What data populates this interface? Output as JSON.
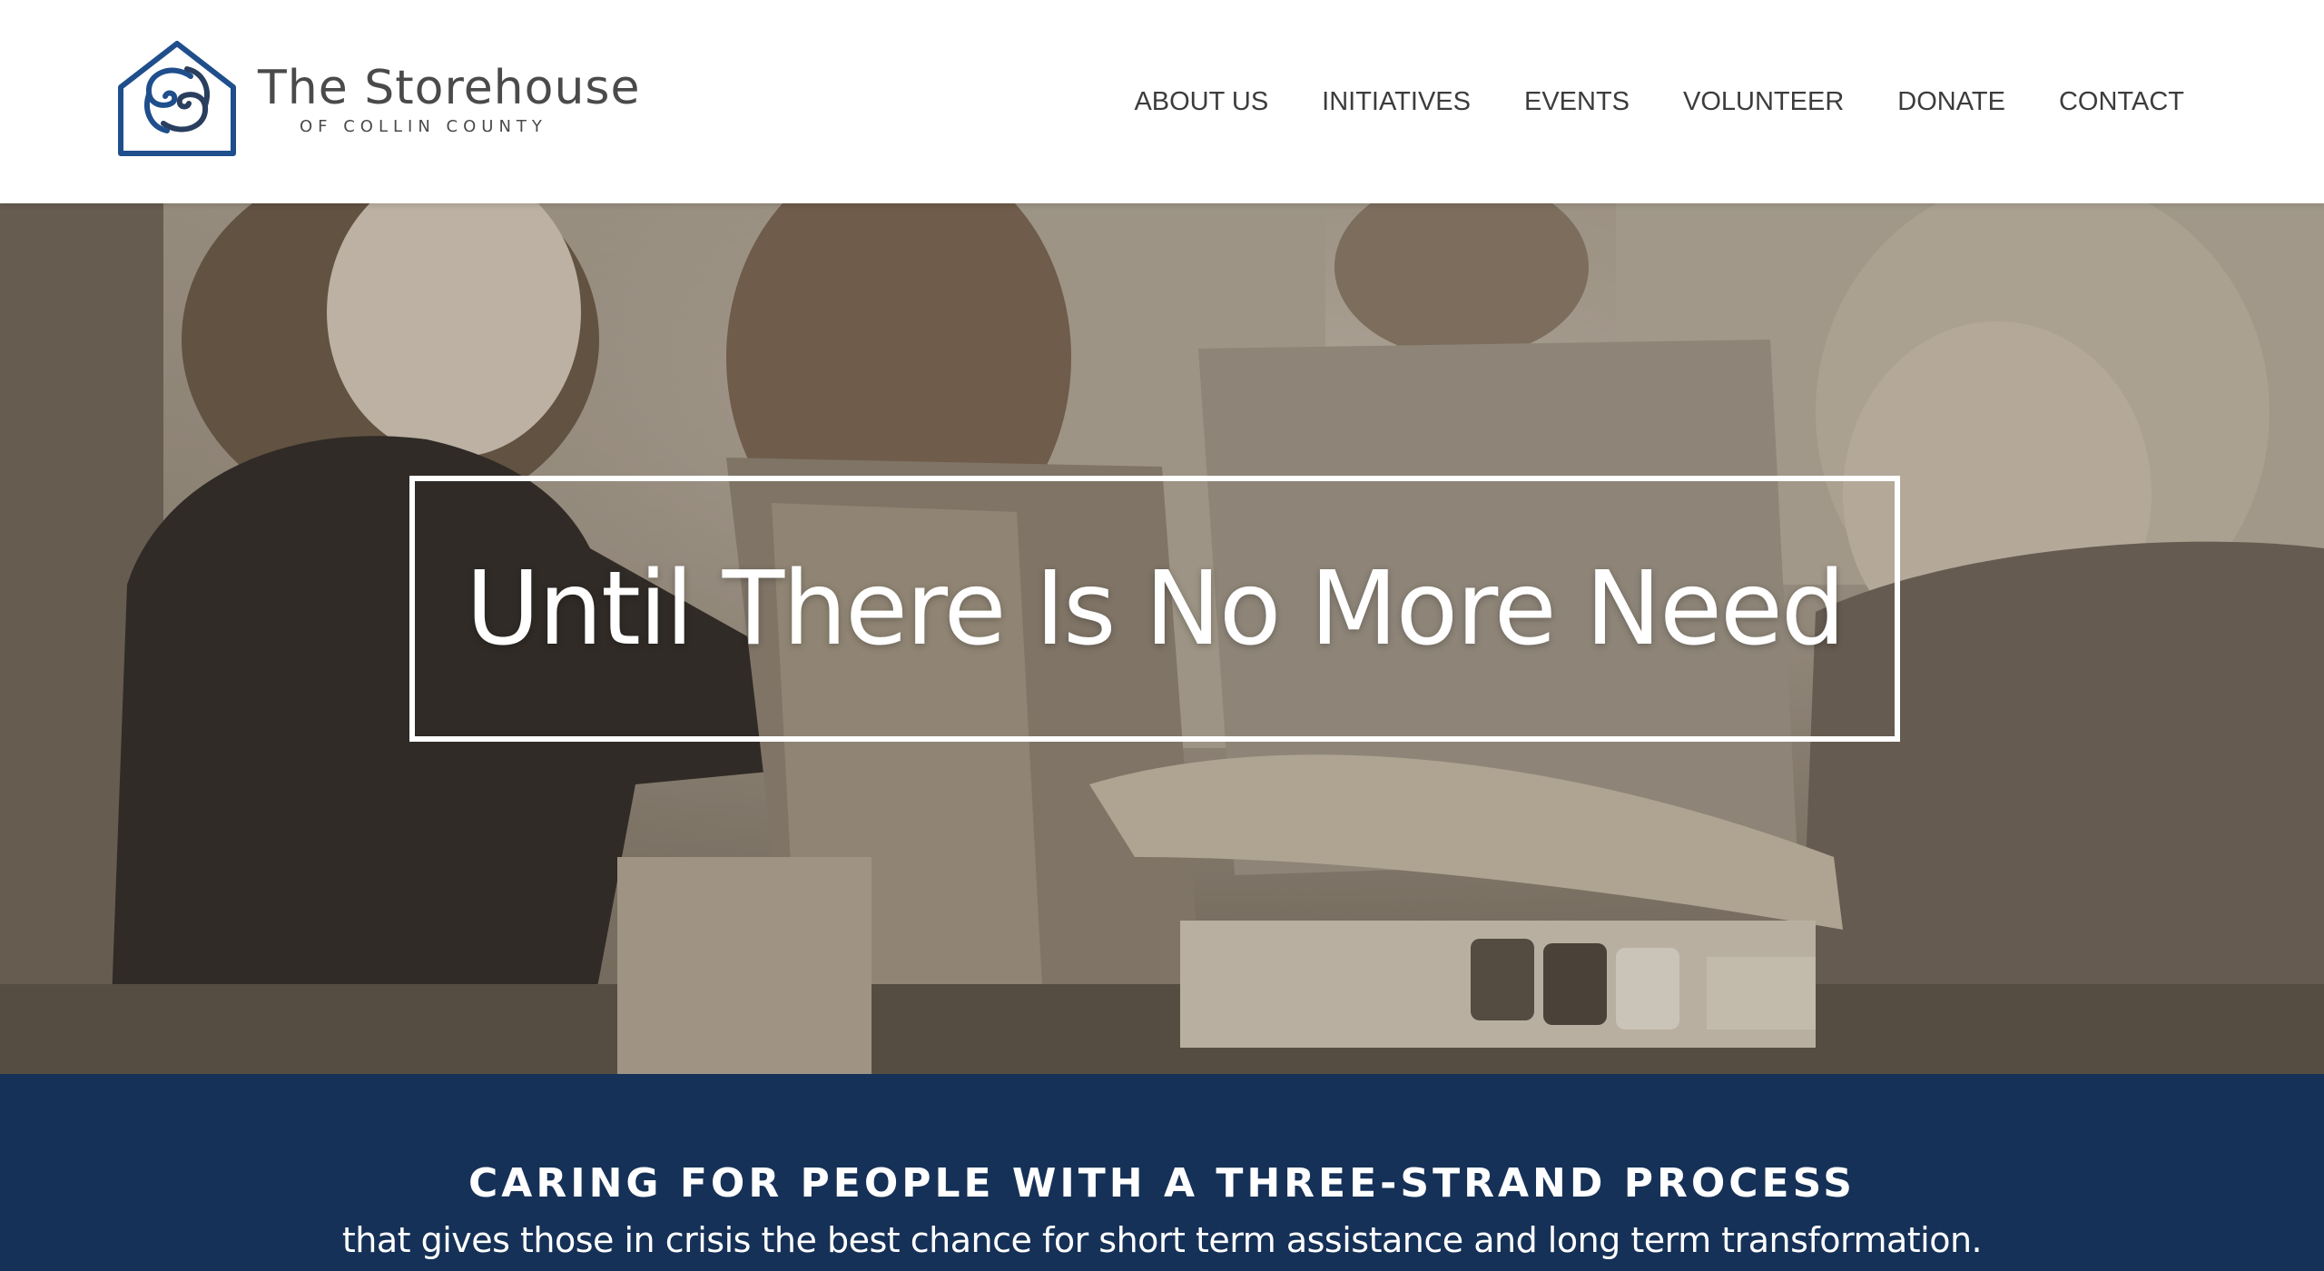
{
  "header": {
    "logo": {
      "title": "The Storehouse",
      "subtitle": "OF COLLIN COUNTY",
      "icon": "house-s-logo-icon",
      "color": "#1f4e8c"
    },
    "nav": [
      {
        "label": "ABOUT US"
      },
      {
        "label": "INITIATIVES"
      },
      {
        "label": "EVENTS"
      },
      {
        "label": "VOLUNTEER"
      },
      {
        "label": "DONATE"
      },
      {
        "label": "CONTACT"
      }
    ]
  },
  "hero": {
    "heading": "Until There Is No More Need",
    "image": "sepia-photo-volunteers-handing-food"
  },
  "banner": {
    "title": "CARING FOR PEOPLE WITH A THREE-STRAND PROCESS",
    "subtitle": "that gives those in crisis the best chance for short term assistance and long term transformation.",
    "background": "#163157"
  }
}
